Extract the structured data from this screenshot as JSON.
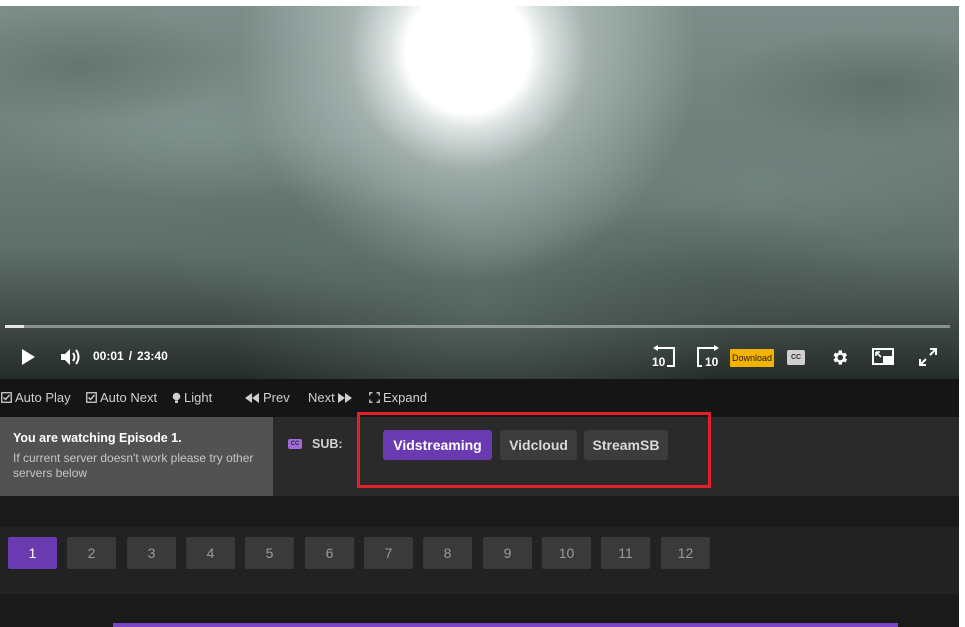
{
  "player": {
    "current_time": "00:01",
    "separator": "/",
    "duration": "23:40",
    "progress": 0.02,
    "download_label": "Download",
    "cc_label": "CC",
    "rewind_label": "10",
    "forward_label": "10",
    "icons": [
      "play-icon",
      "volume-icon",
      "rewind-10-icon",
      "forward-10-icon",
      "settings-icon",
      "pip-icon",
      "fullscreen-icon"
    ]
  },
  "toolbar": {
    "auto_play": "Auto Play",
    "auto_next": "Auto Next",
    "light": "Light",
    "prev": "Prev",
    "next": "Next",
    "expand": "Expand"
  },
  "servers": {
    "watching_title": "You are watching Episode 1.",
    "watching_hint": "If current server doesn't work please try other servers below",
    "sub_label": "SUB:",
    "cc_icon_label": "CC",
    "items": [
      {
        "label": "Vidstreaming",
        "active": true
      },
      {
        "label": "Vidcloud",
        "active": false
      },
      {
        "label": "StreamSB",
        "active": false
      }
    ]
  },
  "episodes": {
    "items": [
      "1",
      "2",
      "3",
      "4",
      "5",
      "6",
      "7",
      "8",
      "9",
      "10",
      "11",
      "12"
    ],
    "active": "1"
  },
  "colors": {
    "accent": "#6a3ab0",
    "highlight": "#e0202a",
    "download": "#f5b300"
  }
}
